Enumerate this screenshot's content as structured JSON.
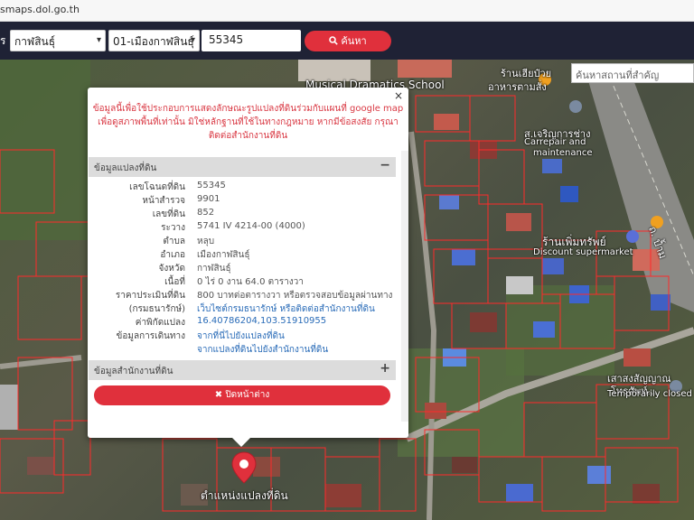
{
  "browser": {
    "url": "smaps.dol.go.th"
  },
  "header": {
    "label": "ร",
    "province": "กาฬสินธุ์",
    "district": "01-เมืองกาฬสินธุ์",
    "parcel_no": "55345",
    "search_label": "ค้นหา"
  },
  "map": {
    "place_search_placeholder": "ค้นหาสถานที่สำคัญ",
    "labels": {
      "school": "Musical Dramatics School",
      "restaurant_th": "ร้านเฮียป๋วย",
      "restaurant_th2": "อาหารตามสั่ง",
      "carrepair_th": "ส.เจริญการช่าง",
      "carrepair_en": "Carrepair and",
      "carrepair_en2": "maintenance",
      "road": "ถ. ป้ำม",
      "supermarket_th": "ร้านเพิ่มทรัพย์",
      "supermarket_en": "Discount supermarket",
      "temple_th": "เสาสงสัญญาณ",
      "temple_th2": "โทรศัพท์...",
      "temporarily_closed": "Temporarily closed",
      "marker_label": "ตำแหน่งแปลงที่ดิน"
    }
  },
  "popup": {
    "close_symbol": "×",
    "notice_line1": "ข้อมูลนี้เพื่อใช้ประกอบการแสดงลักษณะรูปแปลงที่ดินร่วมกับแผนที่ google map",
    "notice_line2": "เพื่อดูสภาพพื้นที่เท่านั้น มิใช่หลักฐานที่ใช้ในทางกฎหมาย หากมีข้อสงสัย กรุณา",
    "notice_line3": "ติดต่อสำนักงานที่ดิน",
    "section1_title": "ข้อมูลแปลงที่ดิน",
    "section1_toggle": "−",
    "rows": [
      {
        "key": "เลขโฉนดที่ดิน",
        "value": "55345"
      },
      {
        "key": "หน้าสำรวจ",
        "value": "9901"
      },
      {
        "key": "เลขที่ดิน",
        "value": "852"
      },
      {
        "key": "ระวาง",
        "value": "5741 IV 4214-00 (4000)"
      },
      {
        "key": "ตำบล",
        "value": "หลุบ"
      },
      {
        "key": "อำเภอ",
        "value": "เมืองกาฬสินธุ์"
      },
      {
        "key": "จังหวัด",
        "value": "กาฬสินธุ์"
      },
      {
        "key": "เนื้อที่",
        "value": "0 ไร่ 0 งาน 64.0 ตารางวา"
      },
      {
        "key": "ราคาประเมินที่ดิน",
        "value": "800 บาทต่อตารางวา หรือตรวจสอบข้อมูลผ่านทาง"
      },
      {
        "key": "(กรมธนารักษ์)",
        "value": "เว็บไซต์กรมธนารักษ์ หรือติดต่อสำนักงานที่ดิน"
      },
      {
        "key": "ค่าพิกัดแปลง",
        "value": "16.40786204,103.51910955"
      },
      {
        "key": "ข้อมูลการเดินทาง",
        "value": "จากที่นี่ไปยังแปลงที่ดิน"
      },
      {
        "key": "",
        "value": "จากแปลงที่ดินไปยังสำนักงานที่ดิน"
      }
    ],
    "section2_title": "ข้อมูลสำนักงานที่ดิน",
    "section2_toggle": "+",
    "close_button_label": "✖ ปิดหน้าต่าง"
  },
  "colors": {
    "accent": "#e0303c",
    "header": "#1f2235",
    "notice": "#d93742",
    "link": "#2a6cb8"
  }
}
